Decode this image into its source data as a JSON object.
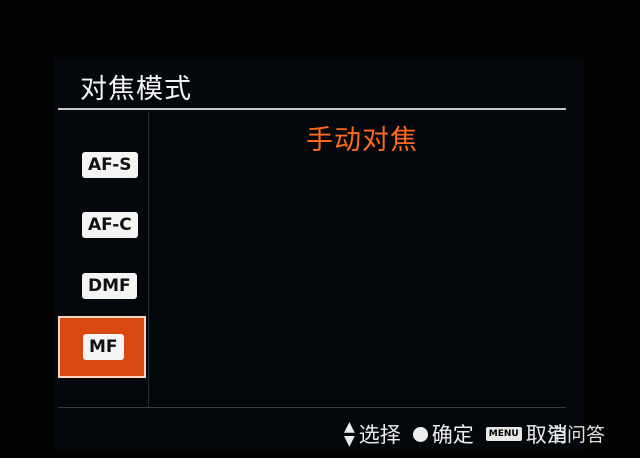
{
  "header": {
    "title": "对焦模式"
  },
  "modes": [
    {
      "label": "AF-S",
      "selected": false
    },
    {
      "label": "AF-C",
      "selected": false
    },
    {
      "label": "DMF",
      "selected": false
    },
    {
      "label": "MF",
      "selected": true
    }
  ],
  "selected_mode_name": "手动对焦",
  "guide": {
    "select_label": "选择",
    "confirm_label": "确定",
    "menu_key": "MENU",
    "cancel_label": "取消"
  },
  "watermark": "空问答",
  "colors": {
    "accent": "#d94712",
    "highlight_text": "#ff6a1a",
    "background": "#04070c"
  }
}
